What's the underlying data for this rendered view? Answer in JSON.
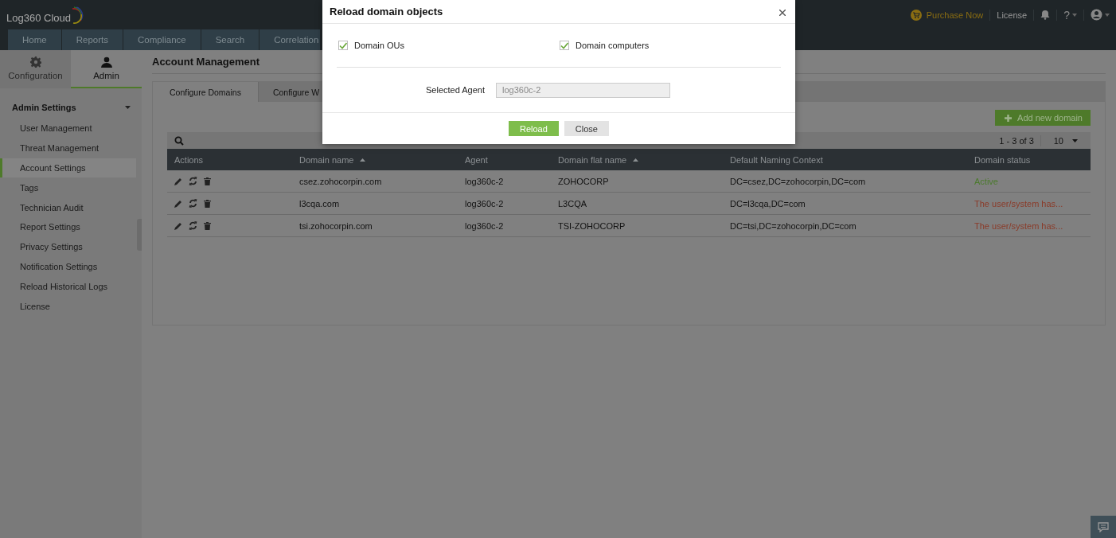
{
  "header": {
    "logo": "Log360 Cloud",
    "purchase": "Purchase Now",
    "license": "License",
    "help": "?"
  },
  "nav_tabs": [
    {
      "label": "Home",
      "selected": false
    },
    {
      "label": "Reports",
      "selected": false
    },
    {
      "label": "Compliance",
      "selected": false
    },
    {
      "label": "Search",
      "selected": false
    },
    {
      "label": "Correlation",
      "selected": false
    }
  ],
  "sidebar": {
    "tabs": [
      {
        "label": "Configuration",
        "selected": false
      },
      {
        "label": "Admin",
        "selected": true
      }
    ],
    "section": "Admin Settings",
    "items": [
      {
        "label": "User Management",
        "selected": false
      },
      {
        "label": "Threat Management",
        "selected": false
      },
      {
        "label": "Account Settings",
        "selected": true
      },
      {
        "label": "Tags",
        "selected": false
      },
      {
        "label": "Technician Audit",
        "selected": false
      },
      {
        "label": "Report Settings",
        "selected": false
      },
      {
        "label": "Privacy Settings",
        "selected": false
      },
      {
        "label": "Notification Settings",
        "selected": false
      },
      {
        "label": "Reload Historical Logs",
        "selected": false
      },
      {
        "label": "License",
        "selected": false
      }
    ]
  },
  "main": {
    "title": "Account Management",
    "tabs": [
      {
        "label": "Configure Domains",
        "selected": true
      },
      {
        "label": "Configure W",
        "selected": false
      }
    ],
    "add_button": "Add new domain",
    "pagination": "1 - 3 of 3",
    "page_size": "10",
    "table": {
      "columns": [
        {
          "label": "Actions",
          "sorted": false
        },
        {
          "label": "Domain name",
          "sorted": true
        },
        {
          "label": "Agent",
          "sorted": false
        },
        {
          "label": "Domain flat name",
          "sorted": true
        },
        {
          "label": "Default Naming Context",
          "sorted": false
        },
        {
          "label": "Domain status",
          "sorted": false
        }
      ],
      "rows": [
        {
          "cells": [
            "",
            "csez.zohocorpin.com",
            "log360c-2",
            "ZOHOCORP",
            "DC=csez,DC=zohocorpin,DC=com"
          ],
          "status": "Active",
          "color": "#4b7a2c"
        },
        {
          "cells": [
            "",
            "l3cqa.com",
            "log360c-2",
            "L3CQA",
            "DC=l3cqa,DC=com"
          ],
          "status": "The user/system has...",
          "color": "#8a3a28"
        },
        {
          "cells": [
            "",
            "tsi.zohocorpin.com",
            "log360c-2",
            "TSI-ZOHOCORP",
            "DC=tsi,DC=zohocorpin,DC=com"
          ],
          "status": "The user/system has...",
          "color": "#8a3a28"
        }
      ]
    }
  },
  "dialog": {
    "title": "Reload domain objects",
    "options": [
      {
        "label": "Domain OUs",
        "checked": true
      },
      {
        "label": "Domain computers",
        "checked": true
      }
    ],
    "agent_label": "Selected Agent",
    "agent_value": "log360c-2",
    "buttons": [
      {
        "label": "Reload",
        "kind": "primary"
      },
      {
        "label": "Close",
        "kind": "secondary"
      }
    ]
  }
}
